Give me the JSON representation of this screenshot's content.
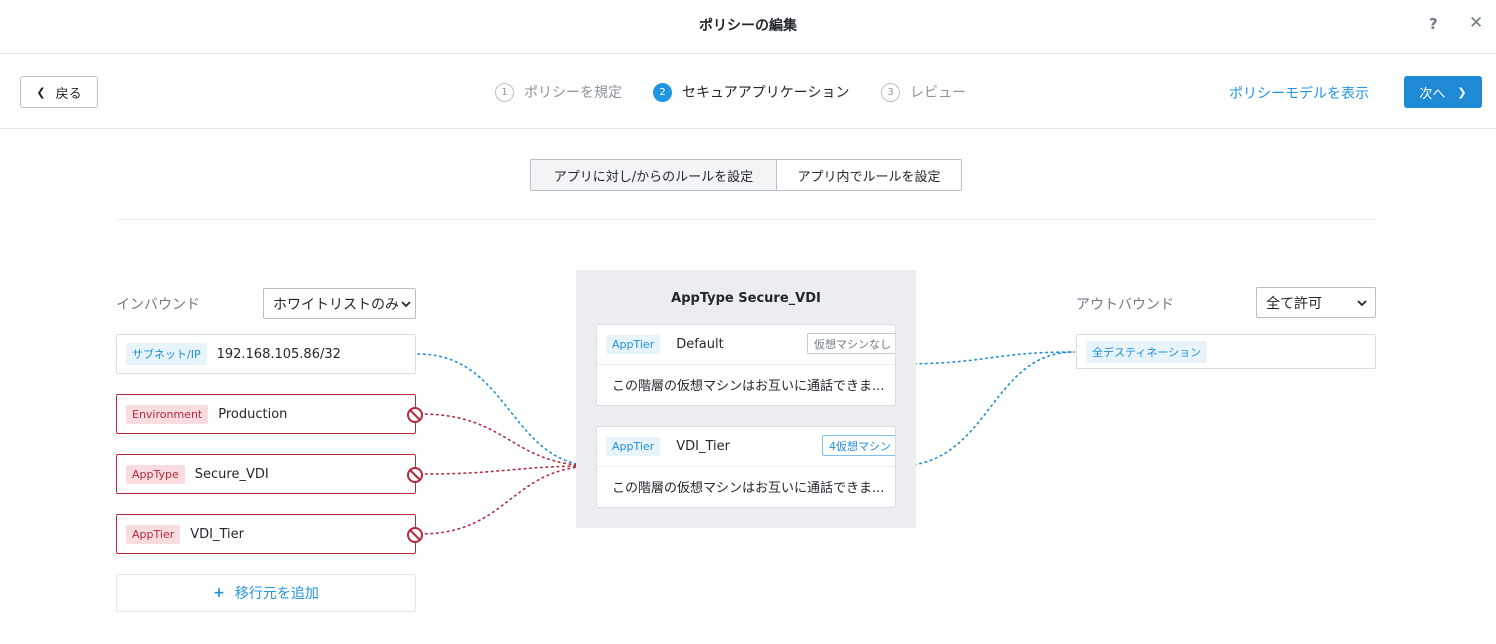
{
  "window": {
    "title": "ポリシーの編集",
    "help_icon": "question-mark-icon",
    "close_icon": "close-icon"
  },
  "wizard": {
    "back_label": "戻る",
    "steps": [
      {
        "number": "1",
        "label": "ポリシーを規定",
        "active": false
      },
      {
        "number": "2",
        "label": "セキュアアプリケーション",
        "active": true
      },
      {
        "number": "3",
        "label": "レビュー",
        "active": false
      }
    ],
    "model_link": "ポリシーモデルを表示",
    "next_label": "次へ"
  },
  "toggle": {
    "options": [
      "アプリに対し/からのルールを設定",
      "アプリ内でルールを設定"
    ],
    "selected": "アプリに対し/からのルールを設定"
  },
  "inbound": {
    "label": "インバウンド",
    "select_value": "ホワイトリストのみ",
    "sources": [
      {
        "tag": "サブネット/IP",
        "value": "192.168.105.86/32",
        "style": "allowed"
      },
      {
        "tag": "Environment",
        "value": "Production",
        "style": "denied"
      },
      {
        "tag": "AppType",
        "value": "Secure_VDI",
        "style": "denied"
      },
      {
        "tag": "AppTier",
        "value": "VDI_Tier",
        "style": "denied"
      }
    ],
    "add_label": "移行元を追加"
  },
  "app": {
    "title": "AppType Secure_VDI",
    "tiers": [
      {
        "tag": "AppTier",
        "name": "Default",
        "vm_badge": "仮想マシンなし",
        "description": "この階層の仮想マシンはお互いに通話できま..."
      },
      {
        "tag": "AppTier",
        "name": "VDI_Tier",
        "vm_badge": "4仮想マシン",
        "description": "この階層の仮想マシンはお互いに通話できま..."
      }
    ]
  },
  "outbound": {
    "label": "アウトバウンド",
    "select_value": "全て許可",
    "destinations": [
      {
        "value": "全デスティネーション"
      }
    ]
  },
  "colors": {
    "accent": "#2196e0",
    "denied": "#b5293d",
    "allowed_link": "#1f8dd6"
  }
}
